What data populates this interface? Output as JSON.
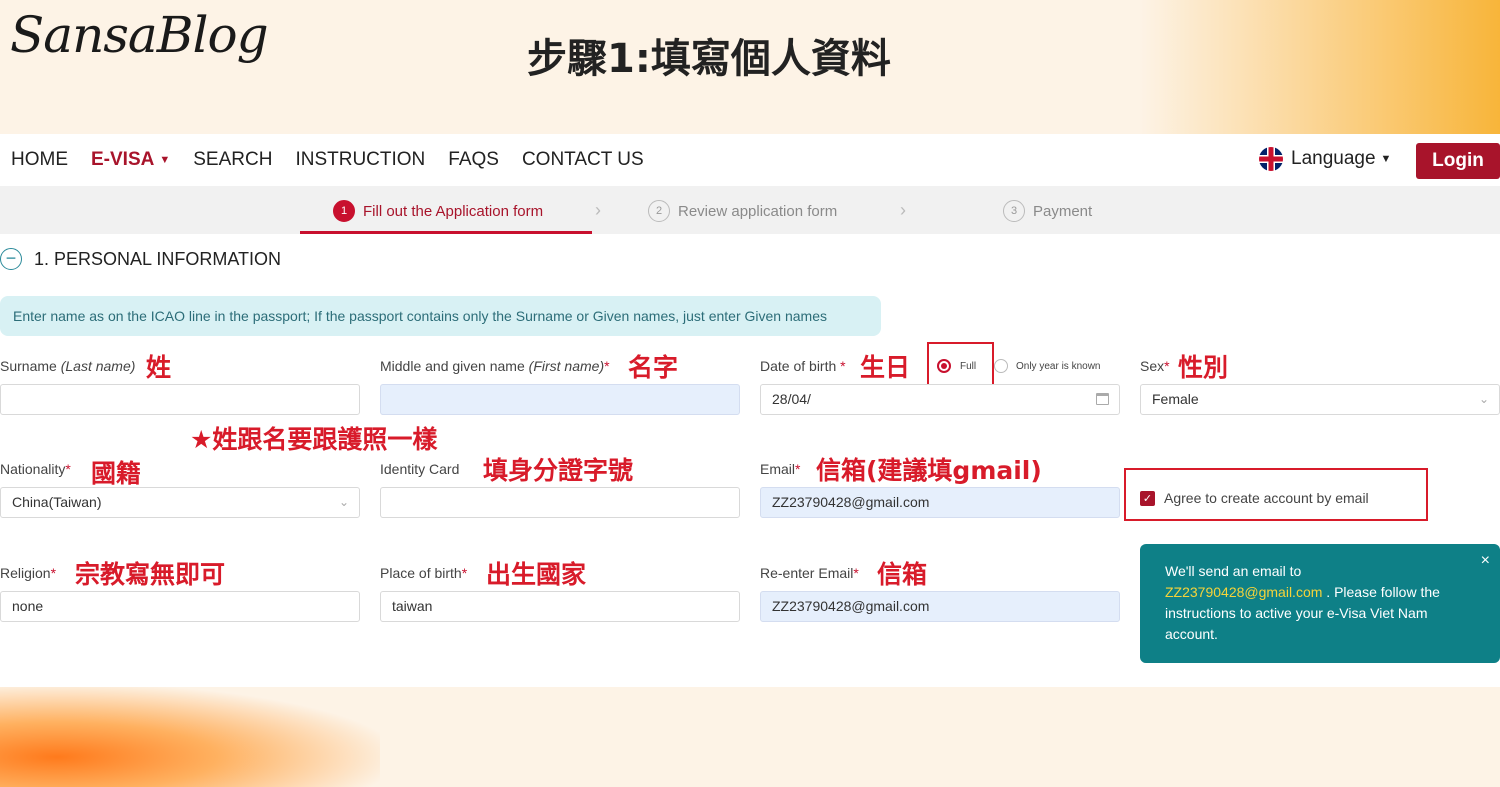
{
  "banner": {
    "logo": "SansaBlog",
    "title": "步驟1:填寫個人資料"
  },
  "nav": {
    "items": [
      "HOME",
      "E-VISA",
      "SEARCH",
      "INSTRUCTION",
      "FAQS",
      "CONTACT US"
    ],
    "language": "Language",
    "login": "Login"
  },
  "steps": [
    {
      "num": "1",
      "label": "Fill out the Application form"
    },
    {
      "num": "2",
      "label": "Review application form"
    },
    {
      "num": "3",
      "label": "Payment"
    }
  ],
  "section": {
    "title": "1. PERSONAL INFORMATION",
    "info": "Enter name as on the ICAO line in the passport; If the passport contains only the Surname or Given names, just enter Given names"
  },
  "fields": {
    "surname": {
      "label": "Surname ",
      "label_em": "(Last name)",
      "value": ""
    },
    "given": {
      "label": "Middle and given name ",
      "label_em": "(First name)",
      "value": ""
    },
    "dob": {
      "label": "Date of birth ",
      "value": "28/04/",
      "opt_full": "Full",
      "opt_year": "Only year is known"
    },
    "sex": {
      "label": "Sex",
      "value": "Female"
    },
    "nationality": {
      "label": "Nationality",
      "value": "China(Taiwan)"
    },
    "identity": {
      "label": "Identity Card",
      "value": ""
    },
    "email": {
      "label": "Email",
      "value": "ZZ23790428@gmail.com"
    },
    "agree": {
      "label": "Agree to create account by email"
    },
    "religion": {
      "label": "Religion",
      "value": "none"
    },
    "pob": {
      "label": "Place of birth",
      "value": "taiwan"
    },
    "reemail": {
      "label": "Re-enter Email",
      "value": "ZZ23790428@gmail.com"
    }
  },
  "required_mark": "*",
  "toast": {
    "line1": "We'll send an email to",
    "email": "ZZ23790428@gmail.com",
    "rest": " . Please follow the instructions to active your e-Visa Viet Nam account.",
    "close": "×"
  },
  "annotations": {
    "surname": "姓",
    "given": "名字",
    "dob": "生日",
    "sex": "性別",
    "name_note": "★姓跟名要跟護照一樣",
    "nationality": "國籍",
    "identity": "填身分證字號",
    "email": "信箱(建議填gmail)",
    "religion": "宗教寫無即可",
    "pob": "出生國家",
    "reemail": "信箱"
  },
  "colors": {
    "brand_red": "#a8142b",
    "annotation_red": "#d81b2a",
    "toast_teal": "#0e8087",
    "info_bg": "#d8f1f4"
  }
}
